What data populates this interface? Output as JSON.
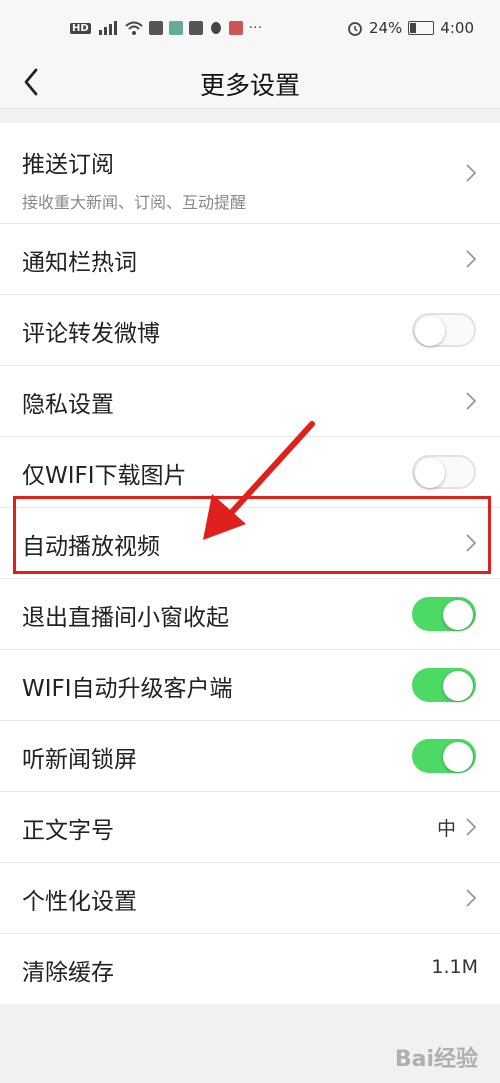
{
  "status_bar": {
    "left_icons": [
      "hd-icon",
      "signal-4g-icon",
      "wifi-icon",
      "card-icon",
      "app-icon",
      "mail-icon",
      "qq-icon",
      "app2-icon",
      "more-dots-icon"
    ],
    "hd": "HD",
    "battery": "24%",
    "time": "4:00"
  },
  "header": {
    "title": "更多设置",
    "back_icon": "back-chevron-icon"
  },
  "settings": [
    {
      "id": "push",
      "label": "推送订阅",
      "subtitle": "接收重大新闻、订阅、互动提醒",
      "control": "chevron"
    },
    {
      "id": "notif-hot",
      "label": "通知栏热词",
      "control": "chevron"
    },
    {
      "id": "comment-weibo",
      "label": "评论转发微博",
      "control": "toggle",
      "on": false
    },
    {
      "id": "privacy",
      "label": "隐私设置",
      "control": "chevron"
    },
    {
      "id": "wifi-images",
      "label": "仅WIFI下载图片",
      "control": "toggle",
      "on": false
    },
    {
      "id": "autoplay",
      "label": "自动播放视频",
      "control": "chevron"
    },
    {
      "id": "live-window",
      "label": "退出直播间小窗收起",
      "control": "toggle",
      "on": true
    },
    {
      "id": "wifi-update",
      "label": "WIFI自动升级客户端",
      "control": "toggle",
      "on": true
    },
    {
      "id": "lockscreen",
      "label": "听新闻锁屏",
      "control": "toggle",
      "on": true
    },
    {
      "id": "font-size",
      "label": "正文字号",
      "value": "中",
      "control": "chevron"
    },
    {
      "id": "personalize",
      "label": "个性化设置",
      "control": "chevron"
    },
    {
      "id": "cache",
      "label": "清除缓存",
      "value": "1.1M",
      "control": "none"
    }
  ],
  "watermark": "Bai经验",
  "colors": {
    "toggle_on": "#4cd964",
    "annotation": "#e0201c"
  }
}
